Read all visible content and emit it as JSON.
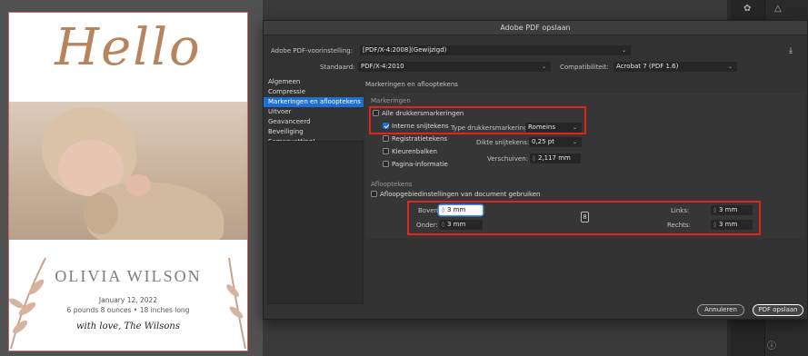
{
  "document": {
    "hello": "Hello",
    "name": "OLIVIA WILSON",
    "date": "January 12, 2022",
    "meta": "6 pounds 8 ounces • 18 inches long",
    "signature": "with love, The Wilsons"
  },
  "dialog": {
    "title": "Adobe PDF opslaan",
    "preset_label": "Adobe PDF-voorinstelling:",
    "preset_value": "[PDF/X-4:2008](Gewijzigd)",
    "standard_label": "Standaard:",
    "standard_value": "PDF/X-4:2010",
    "compat_label": "Compatibiliteit:",
    "compat_value": "Acrobat 7 (PDF 1.6)",
    "nav": [
      {
        "label": "Algemeen"
      },
      {
        "label": "Compressie"
      },
      {
        "label": "Markeringen en aflooptekens"
      },
      {
        "label": "Uitvoer"
      },
      {
        "label": "Geavanceerd"
      },
      {
        "label": "Beveiliging"
      },
      {
        "label": "Samenvatting!"
      }
    ],
    "section_title": "Markeringen en aflooptekens",
    "marks_group": "Markeringen",
    "all_marks": "Alle drukkersmarkeringen",
    "crop_marks": "Interne snijtekens",
    "mark_type_label": "Type drukkersmarkering:",
    "mark_type_value": "Romeins",
    "registration": "Registratietekens",
    "color_bars": "Kleurenbalken",
    "page_info": "Pagina-informatie",
    "weight_label": "Dikte snijtekens:",
    "weight_value": "0,25 pt",
    "offset_label": "Verschuiven:",
    "offset_value": "2,117 mm",
    "bleed_group": "Aflooptekens",
    "use_doc_bleed": "Afloopgebiedinstellingen van document gebruiken",
    "top_label": "Boven:",
    "top_value": "3 mm",
    "bottom_label": "Onder:",
    "bottom_value": "3 mm",
    "left_label": "Links:",
    "left_value": "3 mm",
    "right_label": "Rechts:",
    "right_value": "3 mm",
    "cancel": "Annuleren",
    "save": "PDF opslaan"
  },
  "colors": {
    "accent": "#1f6fd1",
    "highlight": "#e1251b",
    "hello": "#b8845e"
  }
}
